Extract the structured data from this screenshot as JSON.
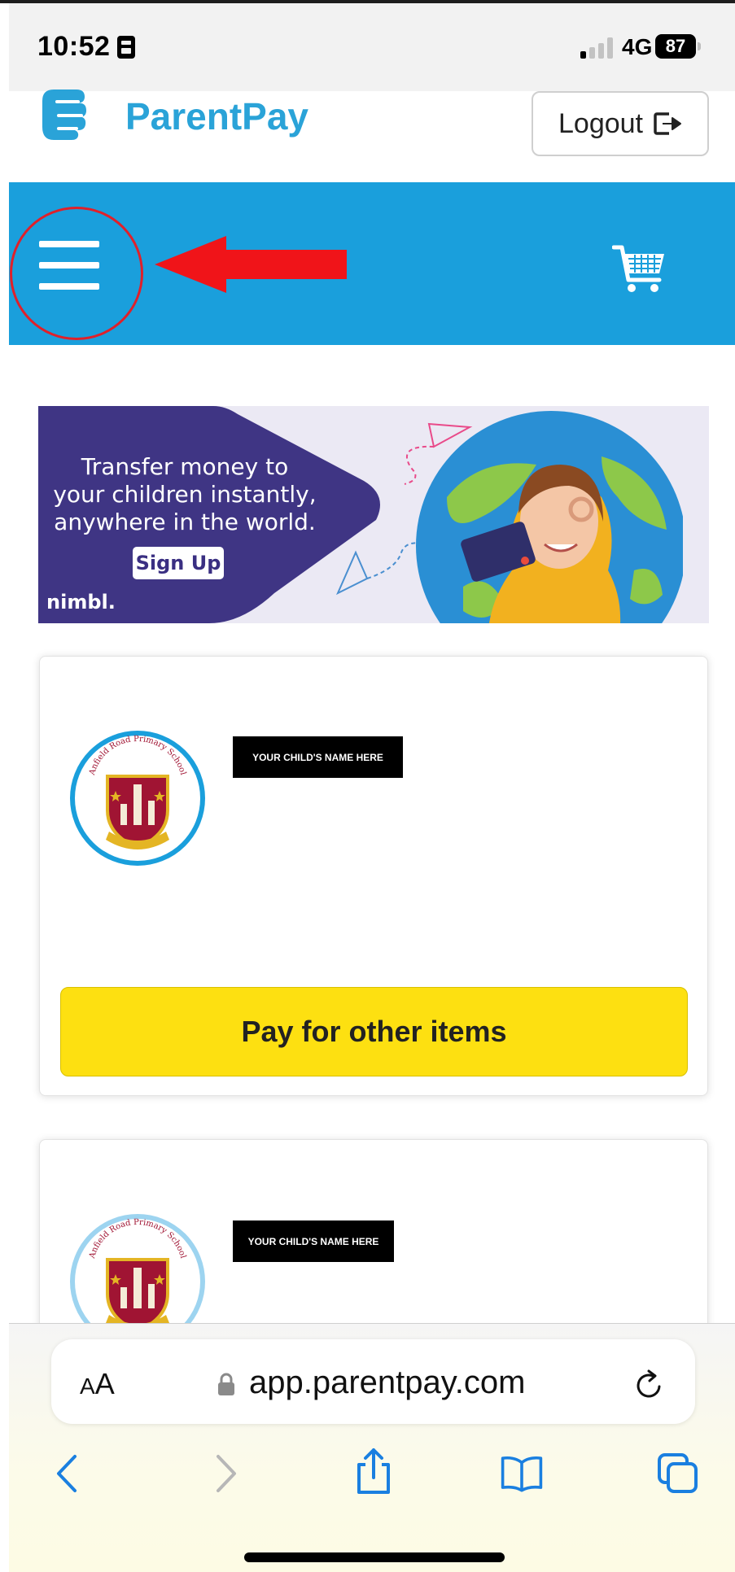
{
  "status_bar": {
    "time": "10:52",
    "network": "4G",
    "battery": "87"
  },
  "header": {
    "brand": "ParentPay",
    "logout_label": "Logout"
  },
  "ad_banner": {
    "line1": "Transfer money to",
    "line2": "your children instantly,",
    "line3": "anywhere in the world.",
    "cta": "Sign Up",
    "brand": "nimbl."
  },
  "children": [
    {
      "name_placeholder": "YOUR CHILD'S NAME HERE",
      "school_crest_text": "Anfield Road Primary School",
      "action_label": "Pay for other items"
    },
    {
      "name_placeholder": "YOUR CHILD'S NAME HERE",
      "school_crest_text": "Anfield Road Primary School"
    }
  ],
  "browser": {
    "text_size_label_small": "A",
    "text_size_label_large": "A",
    "url": "app.parentpay.com"
  },
  "colors": {
    "brand_blue": "#1a9fdc",
    "pay_button_yellow": "#fde011",
    "annotation_red": "#e0202a",
    "ad_purple": "#3f3584"
  },
  "icons": [
    "lock-icon",
    "signal-icon",
    "parentpay-hand-logo-icon",
    "logout-icon",
    "menu-icon",
    "cart-icon",
    "chevron-left-icon",
    "chevron-right-icon",
    "share-icon",
    "bookmarks-icon",
    "tabs-icon",
    "reload-icon"
  ]
}
